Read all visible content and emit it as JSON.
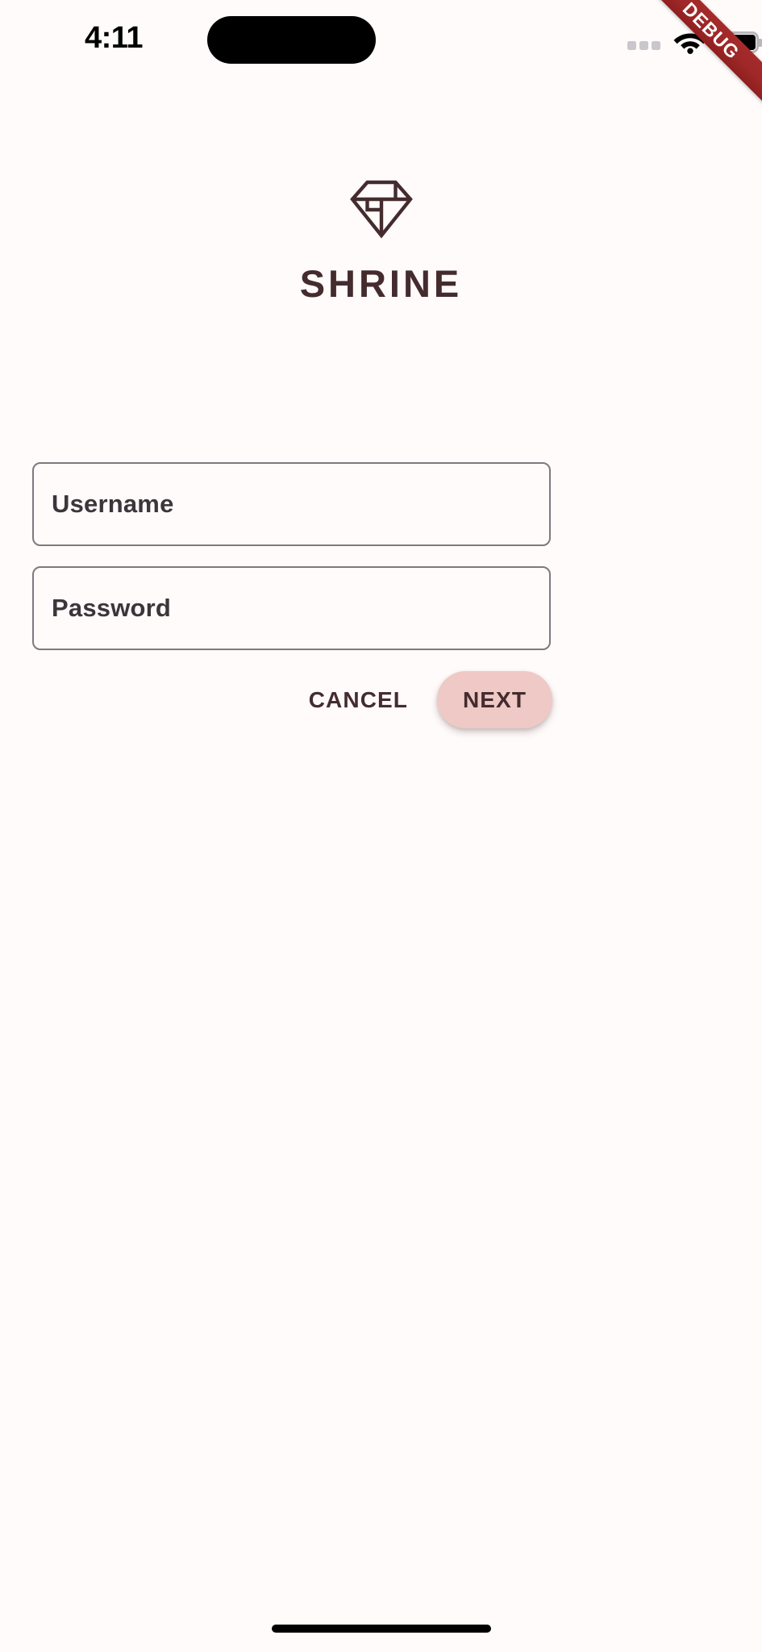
{
  "status_bar": {
    "time": "4:11",
    "cellular_icon": "cellular-dots-icon",
    "wifi_icon": "wifi-icon",
    "battery_icon": "battery-full-icon"
  },
  "debug_banner": {
    "label": "DEBUG",
    "color": "#9e2727",
    "text_color": "#ffffff"
  },
  "brand": {
    "logo_icon": "shrine-diamond-logo",
    "title": "SHRINE",
    "color": "#442C2E"
  },
  "login_form": {
    "fields": [
      {
        "name": "username",
        "label": "Username",
        "value": "",
        "placeholder": "Username"
      },
      {
        "name": "password",
        "label": "Password",
        "value": "",
        "placeholder": "Password"
      }
    ],
    "cancel_label": "CANCEL",
    "next_label": "NEXT",
    "next_button_color": "#EFC9C6",
    "border_color": "#7C7A80",
    "label_color": "#3A363B"
  },
  "system": {
    "home_indicator": "home-indicator-bar",
    "background_color": "#FFFBFA"
  }
}
